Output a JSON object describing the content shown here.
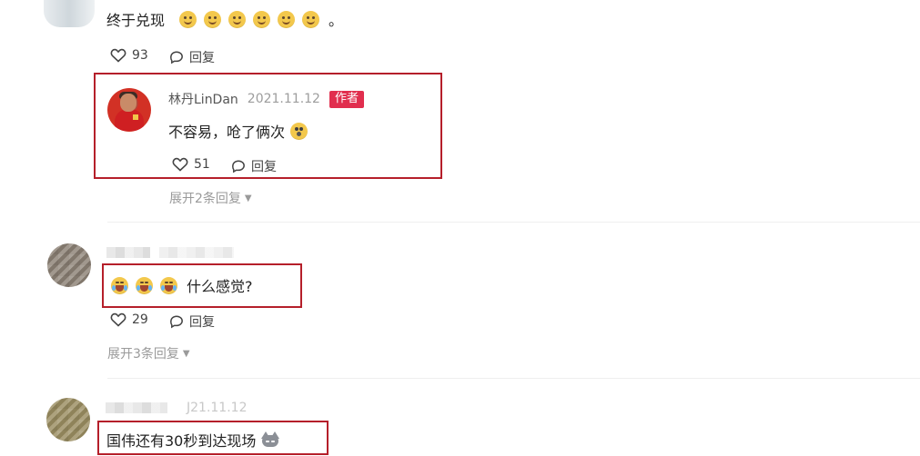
{
  "comments": [
    {
      "text": "终于兑现",
      "ending": "。",
      "likes": "93",
      "reply_label": "回复",
      "emoji_icon": "thinking-face-icon"
    },
    {
      "author": "林丹LinDan",
      "date": "2021.11.12",
      "badge": "作者",
      "text": "不容易，呛了俩次",
      "likes": "51",
      "reply_label": "回复",
      "expand_label": "展开2条回复",
      "emoji_icon": "dizzy-face-icon"
    },
    {
      "text": "什么感觉?",
      "likes": "29",
      "reply_label": "回复",
      "expand_label": "展开3条回复",
      "emoji_icon": "laughing-tears-icon"
    },
    {
      "date": "J21.11.12",
      "text": "国伟还有30秒到达现场",
      "emoji_icon": "cat-icon"
    }
  ],
  "colors": {
    "highlight_border": "#b51f2a",
    "author_badge": "#e12e4e",
    "muted_text": "#8f8f8f"
  }
}
